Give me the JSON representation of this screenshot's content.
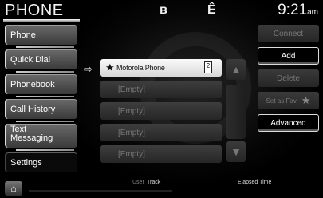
{
  "status_bar": {
    "title": "PHONE",
    "bluetooth_icon": "bluetooth-icon",
    "signal_icon": "signal-icon",
    "time": "9:21",
    "ampm": "am"
  },
  "sidebar": {
    "items": [
      {
        "label": "Phone"
      },
      {
        "label": "Quick Dial"
      },
      {
        "label": "Phonebook"
      },
      {
        "label": "Call History"
      },
      {
        "label_line1": "Text",
        "label_line2": "Messaging"
      },
      {
        "label": "Settings"
      }
    ]
  },
  "quick_dial_list": {
    "selected_indicator_icon": "arrow-right-icon",
    "rows": [
      {
        "label": "Motorola Phone",
        "favorite_icon": "star-icon",
        "badge": "2"
      },
      {
        "label": "[Empty]"
      },
      {
        "label": "[Empty]"
      },
      {
        "label": "[Empty]"
      },
      {
        "label": "[Empty]"
      }
    ],
    "scroll_up_icon": "triangle-up-icon",
    "scroll_down_icon": "triangle-down-icon"
  },
  "actions": {
    "connect_label": "Connect",
    "add_label": "Add",
    "delete_label": "Delete",
    "set_as_fav_label": "Set as Fav",
    "advanced_label": "Advanced"
  },
  "footer": {
    "home_icon": "home-icon",
    "user_label": "User",
    "track_label": "Track",
    "elapsed_label": "Elapsed Time"
  }
}
